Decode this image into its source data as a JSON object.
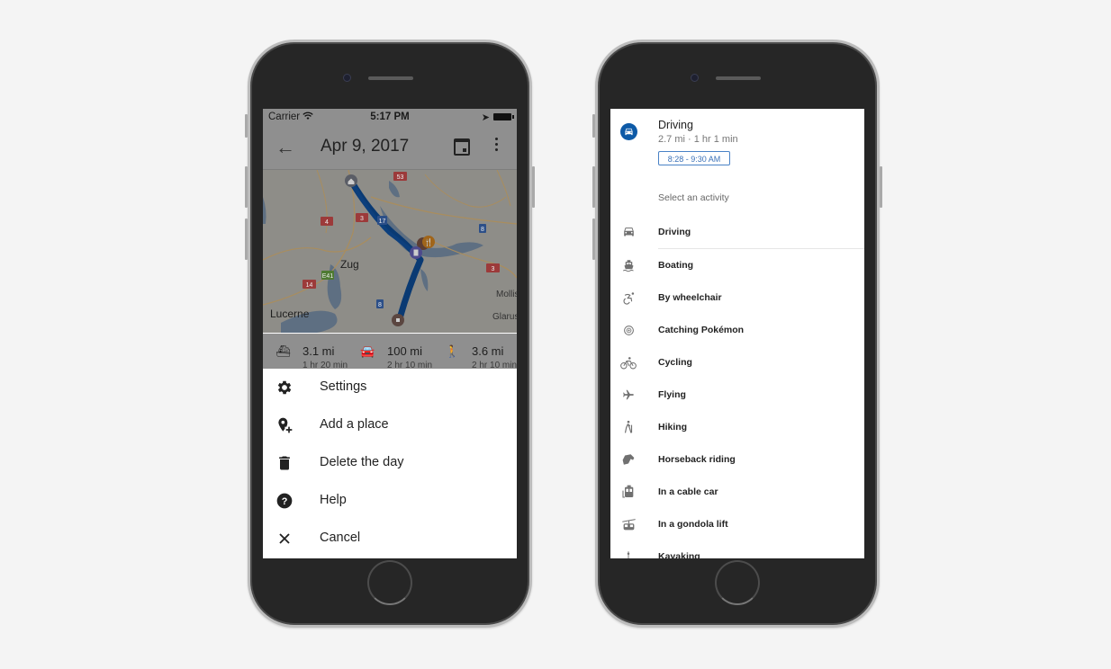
{
  "left_phone": {
    "status_bar": {
      "carrier": "Carrier",
      "time": "5:17 PM",
      "wifi_icon": "wifi-icon",
      "location_icon": "location-arrow-icon",
      "battery_icon": "battery-icon"
    },
    "app_bar": {
      "title": "Apr 9, 2017",
      "back_icon": "arrow-back-icon",
      "calendar_icon": "calendar-icon",
      "more_icon": "more-vert-icon"
    },
    "map": {
      "labels": [
        "Zug",
        "Lucerne",
        "Mollis",
        "Glarus"
      ],
      "road_shields": [
        "53",
        "4",
        "3",
        "17",
        "8",
        "E41",
        "14",
        "3",
        "8"
      ],
      "markers": [
        "home-marker",
        "restaurant-marker",
        "gas-station-marker",
        "end-marker"
      ],
      "route_color": "#0a3a73"
    },
    "stats": [
      {
        "icon": "boating-icon",
        "value": "3.1 mi",
        "sub": "1 hr 20 min"
      },
      {
        "icon": "car-icon",
        "value": "100 mi",
        "sub": "2 hr 10 min"
      },
      {
        "icon": "walking-icon",
        "value": "3.6 mi",
        "sub": "2 hr 10 min"
      }
    ],
    "menu": [
      {
        "icon": "gear-icon",
        "label": "Settings"
      },
      {
        "icon": "add-place-icon",
        "label": "Add a place"
      },
      {
        "icon": "trash-icon",
        "label": "Delete the day"
      },
      {
        "icon": "help-icon",
        "label": "Help"
      },
      {
        "icon": "close-icon",
        "label": "Cancel"
      }
    ]
  },
  "right_phone": {
    "segment": {
      "activity": "Driving",
      "meta": "2.7 mi · 1 hr 1 min",
      "time_range": "8:28 - 9:30 AM",
      "badge_color": "#0d5aa7"
    },
    "select_prompt": "Select an activity",
    "activities": [
      {
        "icon": "car-icon",
        "label": "Driving"
      },
      {
        "icon": "boat-icon",
        "label": "Boating"
      },
      {
        "icon": "wheelchair-icon",
        "label": "By wheelchair"
      },
      {
        "icon": "pokeball-icon",
        "label": "Catching Pokémon"
      },
      {
        "icon": "bicycle-icon",
        "label": "Cycling"
      },
      {
        "icon": "airplane-icon",
        "label": "Flying"
      },
      {
        "icon": "hiking-icon",
        "label": "Hiking"
      },
      {
        "icon": "horse-icon",
        "label": "Horseback riding"
      },
      {
        "icon": "cable-car-icon",
        "label": "In a cable car"
      },
      {
        "icon": "gondola-icon",
        "label": "In a gondola lift"
      },
      {
        "icon": "kayak-icon",
        "label": "Kayaking"
      }
    ]
  }
}
